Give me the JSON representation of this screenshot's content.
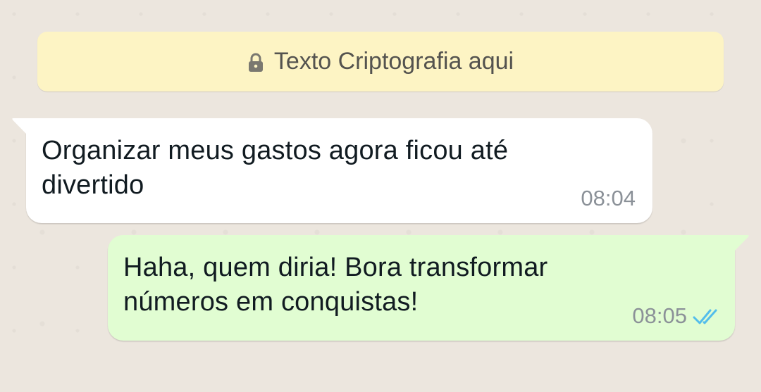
{
  "banner": {
    "text": "Texto Criptografia aqui",
    "icon": "lock-icon"
  },
  "messages": [
    {
      "direction": "incoming",
      "text": "Organizar meus gastos agora ficou até\ndivertido",
      "time": "08:04"
    },
    {
      "direction": "outgoing",
      "text": "Haha, quem diria! Bora transformar\nnúmeros em conquistas!",
      "time": "08:05",
      "status": "read",
      "status_icon": "double-check-icon"
    }
  ],
  "colors": {
    "chat_background": "#ece6de",
    "banner_background": "#fdf4c4",
    "incoming_bubble": "#ffffff",
    "outgoing_bubble": "#e1fdd2",
    "read_check": "#53bdeb",
    "timestamp": "#8b9198"
  }
}
